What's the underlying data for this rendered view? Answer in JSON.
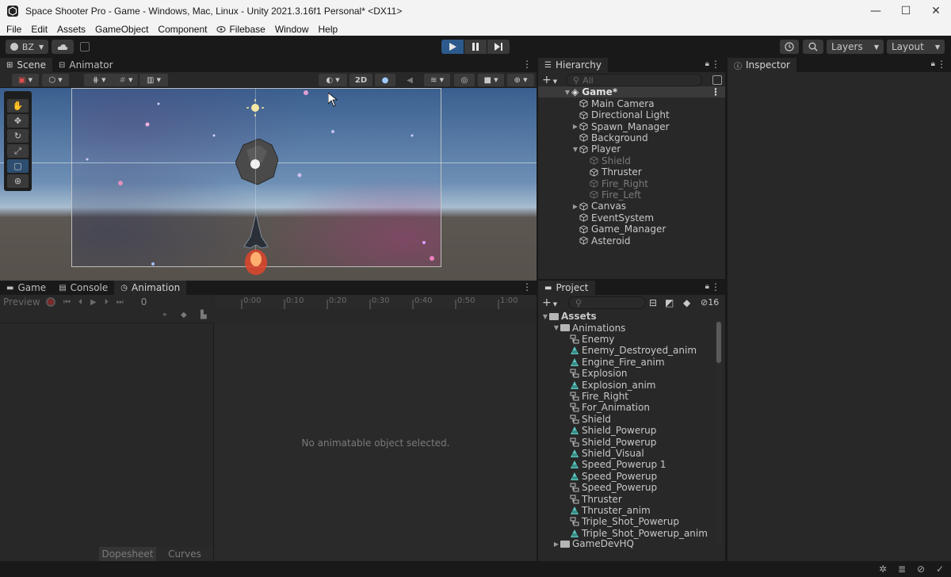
{
  "window": {
    "title": "Space Shooter Pro - Game - Windows, Mac, Linux - Unity 2021.3.16f1 Personal* <DX11>",
    "minimize": "—",
    "maximize": "☐",
    "close": "✕"
  },
  "menu": [
    "File",
    "Edit",
    "Assets",
    "GameObject",
    "Component",
    "Filebase",
    "Window",
    "Help"
  ],
  "toolbar": {
    "account": "BZ",
    "layers": "Layers",
    "layout": "Layout"
  },
  "scene_panel": {
    "tabs": [
      "Scene",
      "Animator"
    ],
    "btn_2d": "2D"
  },
  "hierarchy": {
    "tab": "Hierarchy",
    "search_placeholder": "All",
    "scene_name": "Game*",
    "items": [
      {
        "label": "Main Camera"
      },
      {
        "label": "Directional Light"
      },
      {
        "label": "Spawn_Manager"
      },
      {
        "label": "Background"
      },
      {
        "label": "Player"
      },
      {
        "label": "Shield"
      },
      {
        "label": "Thruster"
      },
      {
        "label": "Fire_Right"
      },
      {
        "label": "Fire_Left"
      },
      {
        "label": "Canvas"
      },
      {
        "label": "EventSystem"
      },
      {
        "label": "Game_Manager"
      },
      {
        "label": "Asteroid"
      }
    ]
  },
  "inspector": {
    "tab": "Inspector"
  },
  "bottom_panel": {
    "tabs": [
      "Game",
      "Console",
      "Animation"
    ],
    "preview": "Preview",
    "frame": "0",
    "ruler": [
      "0:00",
      "0:10",
      "0:20",
      "0:30",
      "0:40",
      "0:50",
      "1:00"
    ],
    "empty_message": "No animatable object selected.",
    "dopesheet": "Dopesheet",
    "curves": "Curves"
  },
  "project": {
    "tab": "Project",
    "hidden_count": "16",
    "assets": "Assets",
    "animations": "Animations",
    "items": [
      {
        "label": "Enemy",
        "kind": "controller"
      },
      {
        "label": "Enemy_Destroyed_anim",
        "kind": "clip"
      },
      {
        "label": "Engine_Fire_anim",
        "kind": "clip"
      },
      {
        "label": "Explosion",
        "kind": "controller"
      },
      {
        "label": "Explosion_anim",
        "kind": "clip"
      },
      {
        "label": "Fire_Right",
        "kind": "controller"
      },
      {
        "label": "For_Animation",
        "kind": "controller"
      },
      {
        "label": "Shield",
        "kind": "controller"
      },
      {
        "label": "Shield_Powerup",
        "kind": "clip"
      },
      {
        "label": "Shield_Powerup",
        "kind": "controller"
      },
      {
        "label": "Shield_Visual",
        "kind": "clip"
      },
      {
        "label": "Speed_Powerup 1",
        "kind": "clip"
      },
      {
        "label": "Speed_Powerup",
        "kind": "clip"
      },
      {
        "label": "Speed_Powerup",
        "kind": "controller"
      },
      {
        "label": "Thruster",
        "kind": "controller"
      },
      {
        "label": "Thruster_anim",
        "kind": "clip"
      },
      {
        "label": "Triple_Shot_Powerup",
        "kind": "controller"
      },
      {
        "label": "Triple_Shot_Powerup_anim",
        "kind": "clip"
      }
    ],
    "next_folder": "GameDevHQ"
  }
}
